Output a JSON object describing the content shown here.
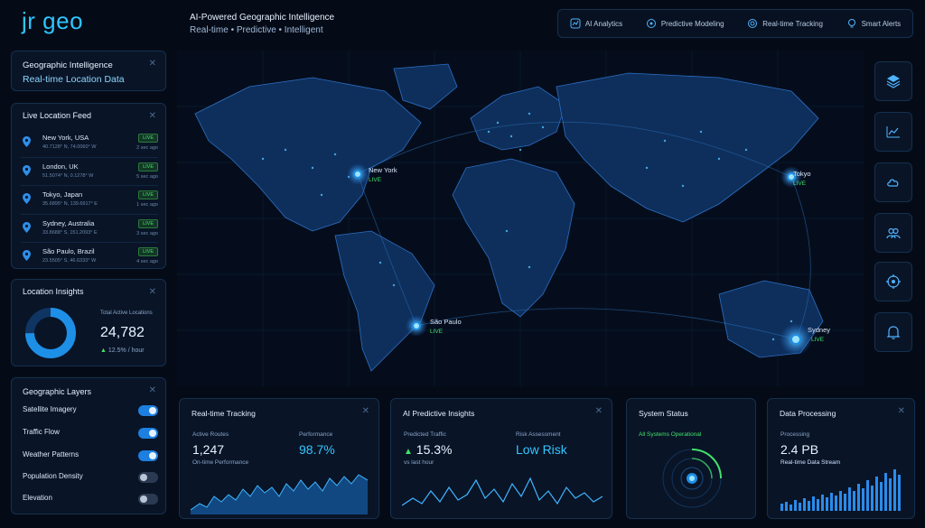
{
  "header": {
    "logo": "jr geo",
    "tagline_line1": "AI-Powered Geographic Intelligence",
    "tagline_line2": "Real-time • Predictive • Intelligent",
    "nav": [
      {
        "label": "AI Analytics",
        "icon": "analytics-icon"
      },
      {
        "label": "Predictive Modeling",
        "icon": "network-icon"
      },
      {
        "label": "Real-time Tracking",
        "icon": "tracking-icon"
      },
      {
        "label": "Smart Alerts",
        "icon": "bulb-icon"
      }
    ]
  },
  "intel_panel": {
    "title": "Geographic Intelligence",
    "subtitle": "Real-time Location Data"
  },
  "feed": {
    "title": "Live Location Feed",
    "items": [
      {
        "city": "New York, USA",
        "coords": "40.7128° N, 74.0060° W",
        "status": "LIVE",
        "time": "2 sec ago"
      },
      {
        "city": "London, UK",
        "coords": "51.5074° N, 0.1278° W",
        "status": "LIVE",
        "time": "5 sec ago"
      },
      {
        "city": "Tokyo, Japan",
        "coords": "35.6895° N, 139.6917° E",
        "status": "LIVE",
        "time": "1 sec ago"
      },
      {
        "city": "Sydney, Australia",
        "coords": "33.8688° S, 151.2093° E",
        "status": "LIVE",
        "time": "3 sec ago"
      },
      {
        "city": "São Paulo, Brazil",
        "coords": "23.5505° S, 46.6333° W",
        "status": "LIVE",
        "time": "4 sec ago"
      }
    ]
  },
  "insights": {
    "title": "Location Insights",
    "label": "Total Active Locations",
    "value": "24,782",
    "delta": "12.5%",
    "delta_suffix": "/ hour"
  },
  "layers": {
    "title": "Geographic Layers",
    "items": [
      {
        "label": "Satellite Imagery",
        "on": true
      },
      {
        "label": "Traffic Flow",
        "on": true
      },
      {
        "label": "Weather Patterns",
        "on": true
      },
      {
        "label": "Population Density",
        "on": false
      },
      {
        "label": "Elevation",
        "on": false
      }
    ]
  },
  "map": {
    "markers": [
      {
        "name": "New York",
        "status": "LIVE"
      },
      {
        "name": "Tokyo",
        "status": "LIVE"
      },
      {
        "name": "São Paulo",
        "status": "LIVE"
      },
      {
        "name": "Sydney",
        "status": "LIVE"
      }
    ]
  },
  "side_buttons": [
    "layers-icon",
    "chart-icon",
    "cloud-icon",
    "users-icon",
    "target-icon",
    "bell-icon"
  ],
  "tracking": {
    "title": "Real-time Tracking",
    "routes_label": "Active Routes",
    "routes_value": "1,247",
    "perf_label": "Performance",
    "perf_value": "98.7%",
    "caption": "On-time Performance"
  },
  "ai": {
    "title": "AI Predictive Insights",
    "traffic_label": "Predicted Traffic",
    "traffic_value": "15.3%",
    "traffic_caption": "vs last hour",
    "risk_label": "Risk Assessment",
    "risk_value": "Low Risk"
  },
  "system": {
    "title": "System Status",
    "status": "All Systems Operational"
  },
  "data_proc": {
    "title": "Data Processing",
    "label": "Processing",
    "value": "2.4 PB",
    "caption": "Real-time Data Stream"
  },
  "colors": {
    "accent": "#2fc4ff",
    "live": "#42e26a",
    "background": "#050b16"
  }
}
